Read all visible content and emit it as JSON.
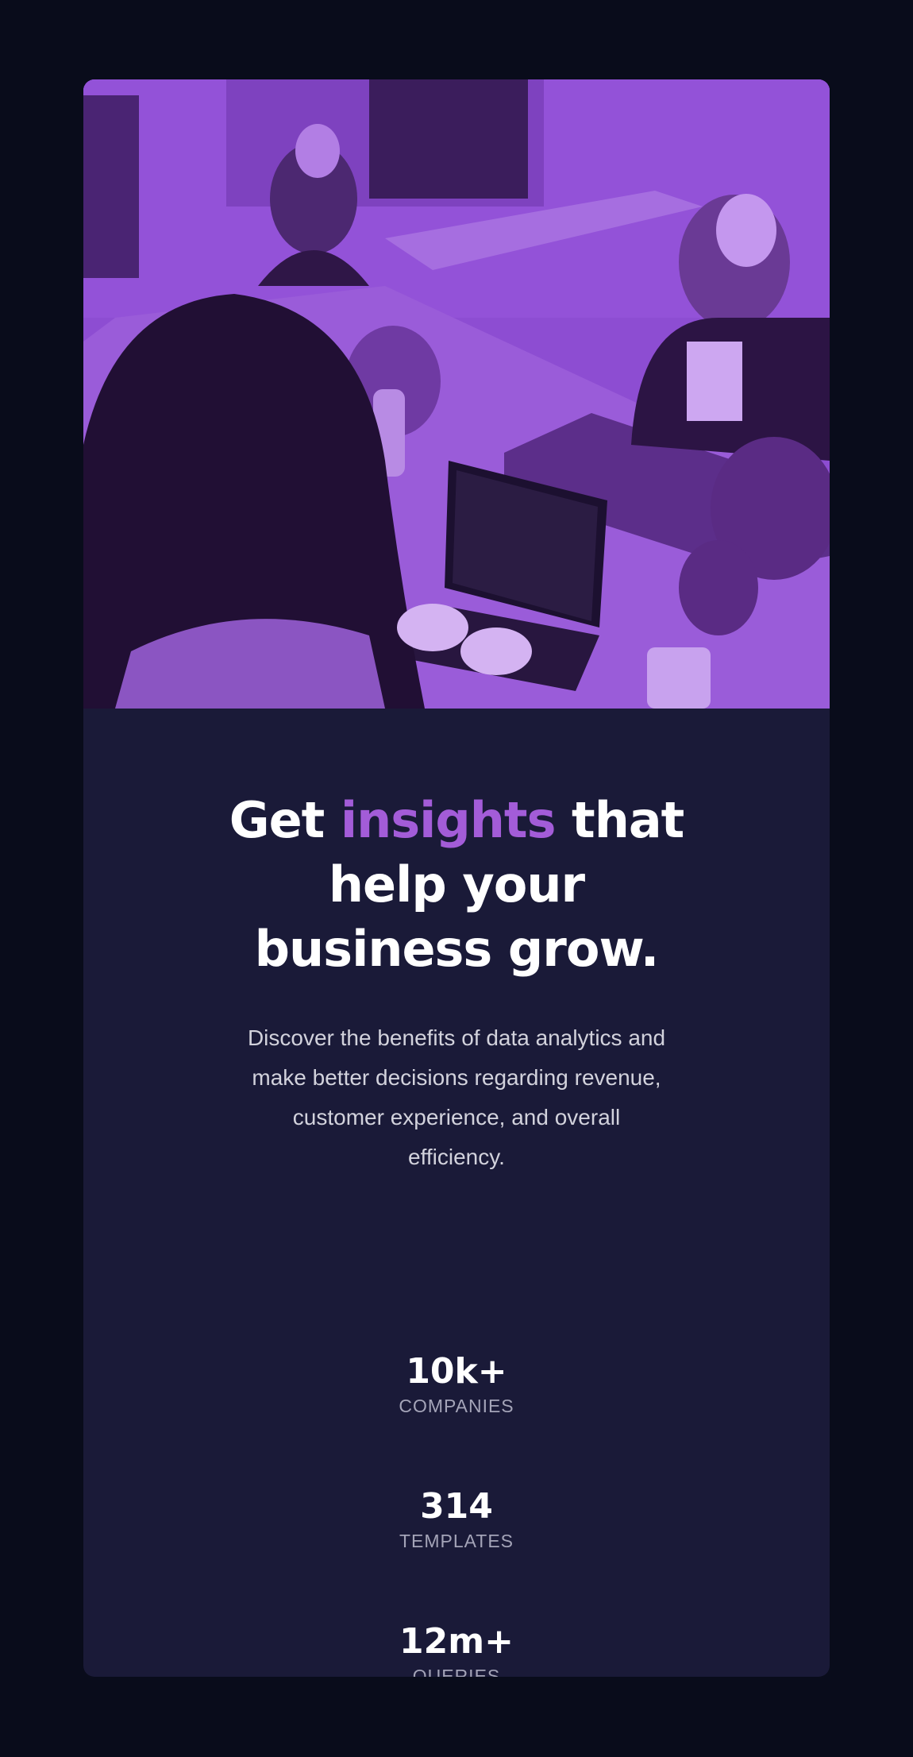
{
  "hero": {
    "image": "purple-tinted photo of coworkers at a table with a laptop",
    "tint_color": "#8a4bd0"
  },
  "headline": {
    "before": "Get ",
    "accent": "insights",
    "after": " that help your business grow."
  },
  "description": "Discover the benefits of data analytics and make better decisions regarding revenue, customer experience, and overall efficiency.",
  "stats": [
    {
      "value": "10k+",
      "label": "COMPANIES"
    },
    {
      "value": "314",
      "label": "TEMPLATES"
    },
    {
      "value": "12m+",
      "label": "QUERIES"
    }
  ],
  "colors": {
    "page_background": "#090c1b",
    "card_background": "#1a1a38",
    "accent": "#a35cd8",
    "text_primary": "#ffffff",
    "text_secondary": "#d2d2dc",
    "text_muted": "#a4a4b8"
  }
}
